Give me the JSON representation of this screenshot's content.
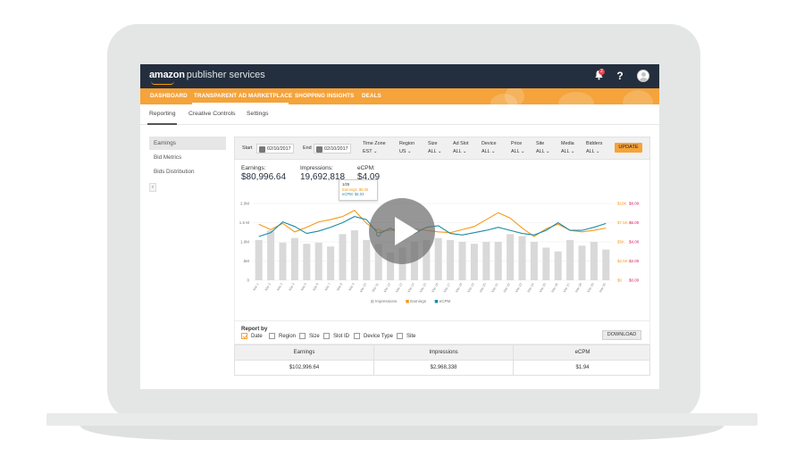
{
  "header": {
    "brand_main": "amazon",
    "brand_sub": "publisher services",
    "notification_count": "2",
    "help_label": "?"
  },
  "nav": {
    "items": [
      "DASHBOARD",
      "TRANSPARENT AD MARKETPLACE",
      "SHOPPING INSIGHTS",
      "DEALS"
    ],
    "active": "TRANSPARENT AD MARKETPLACE"
  },
  "subtabs": {
    "items": [
      "Reporting",
      "Creative Controls",
      "Settings"
    ],
    "active": "Reporting"
  },
  "sidebar": {
    "items": [
      "Earnings",
      "Bid Metrics",
      "Bids Distribution"
    ],
    "active": "Earnings",
    "collapse_glyph": "‹"
  },
  "filters": {
    "start_label": "Start",
    "start_date": "02/10/2017",
    "end_label": "End",
    "end_date": "02/10/2017",
    "dropdowns": [
      {
        "label": "Time Zone",
        "value": "EST"
      },
      {
        "label": "Region",
        "value": "US"
      },
      {
        "label": "Size",
        "value": "ALL"
      },
      {
        "label": "Ad Slot",
        "value": "ALL"
      },
      {
        "label": "Device",
        "value": "ALL"
      },
      {
        "label": "Price",
        "value": "ALL"
      },
      {
        "label": "Site",
        "value": "ALL"
      },
      {
        "label": "Media",
        "value": "ALL"
      },
      {
        "label": "Bidders",
        "value": "ALL"
      }
    ],
    "update_label": "UPDATE"
  },
  "kpis": [
    {
      "label": "Earnings:",
      "value": "$80,996.64"
    },
    {
      "label": "Impressions:",
      "value": "19,692,818"
    },
    {
      "label": "eCPM:",
      "value": "$4.09"
    }
  ],
  "tooltip": {
    "date": "1/25",
    "earnings": "Earnings: $5.06",
    "ecpm": "eCPM: $4.03"
  },
  "colors": {
    "earnings": "#f59a1b",
    "ecpm": "#1a8ca6",
    "ecpm_axis": "#d81b60",
    "impressions_bar": "#d9d9d9",
    "brand_dark": "#232f3e",
    "accent": "#f5a33a"
  },
  "chart_data": {
    "type": "bar",
    "categories": [
      "Mar 1",
      "Mar 2",
      "Mar 3",
      "Mar 4",
      "Mar 5",
      "Mar 6",
      "Mar 7",
      "Mar 8",
      "Mar 9",
      "Mar 10",
      "Mar 11",
      "Mar 12",
      "Mar 13",
      "Mar 14",
      "Mar 15",
      "Mar 16",
      "Mar 17",
      "Mar 18",
      "Mar 19",
      "Mar 20",
      "Mar 21",
      "Mar 22",
      "Mar 23",
      "Mar 24",
      "Mar 25",
      "Mar 26",
      "Mar 27",
      "Mar 28",
      "Mar 29",
      "Mar 30"
    ],
    "series": [
      {
        "name": "Impressions",
        "kind": "bar",
        "axis": "left",
        "values": [
          1.05,
          1.3,
          0.98,
          1.1,
          0.95,
          0.98,
          0.88,
          1.2,
          1.3,
          1.05,
          0.95,
          0.72,
          0.85,
          1.0,
          1.05,
          1.1,
          1.05,
          1.0,
          0.95,
          1.0,
          1.0,
          1.2,
          1.15,
          1.0,
          0.85,
          0.75,
          1.05,
          0.9,
          1.0,
          0.8
        ]
      },
      {
        "name": "Earnings",
        "kind": "line",
        "axis": "right",
        "values": [
          7.3,
          6.6,
          7.4,
          6.3,
          6.9,
          7.6,
          7.9,
          8.3,
          9.1,
          7.4,
          6.4,
          6.5,
          6.8,
          6.7,
          6.5,
          6.3,
          6.2,
          6.6,
          7.0,
          7.9,
          8.8,
          8.1,
          6.8,
          5.7,
          6.7,
          7.3,
          6.5,
          6.3,
          6.5,
          6.8
        ]
      },
      {
        "name": "eCPM",
        "kind": "line",
        "axis": "right",
        "values": [
          5.7,
          6.2,
          7.6,
          7.0,
          6.1,
          6.4,
          6.9,
          7.5,
          8.3,
          7.9,
          6.0,
          6.8,
          5.9,
          6.1,
          6.9,
          7.1,
          6.1,
          5.9,
          6.2,
          6.5,
          6.9,
          6.5,
          6.1,
          5.9,
          6.5,
          7.5,
          6.5,
          6.5,
          6.9,
          7.4
        ]
      }
    ],
    "left_ticks": [
      "0",
      ".5M",
      "1.0M",
      "1.5 M",
      "2.0M"
    ],
    "right_ticks_earnings": [
      "$0",
      "$2.5K",
      "$5K",
      "$7.5K",
      "$10K"
    ],
    "right_ticks_ecpm": [
      "$0.00",
      "$2.00",
      "$4.00",
      "$6.00",
      "$8.00"
    ],
    "ylim_left": [
      0,
      2.0
    ],
    "ylim_right": [
      0,
      10
    ],
    "legend_position": "bottom",
    "grid": "horizontal"
  },
  "report": {
    "title": "Report by",
    "options": [
      {
        "label": "Date",
        "checked": true
      },
      {
        "label": "Region",
        "checked": false
      },
      {
        "label": "Size",
        "checked": false
      },
      {
        "label": "Slot ID",
        "checked": false
      },
      {
        "label": "Device Type",
        "checked": false
      },
      {
        "label": "Site",
        "checked": false
      }
    ],
    "download_label": "DOWNLOAD"
  },
  "summary_table": {
    "headers": [
      "Earnings",
      "Impressions",
      "eCPM"
    ],
    "row": [
      "$102,996.64",
      "$2,968,338",
      "$1.94"
    ]
  }
}
